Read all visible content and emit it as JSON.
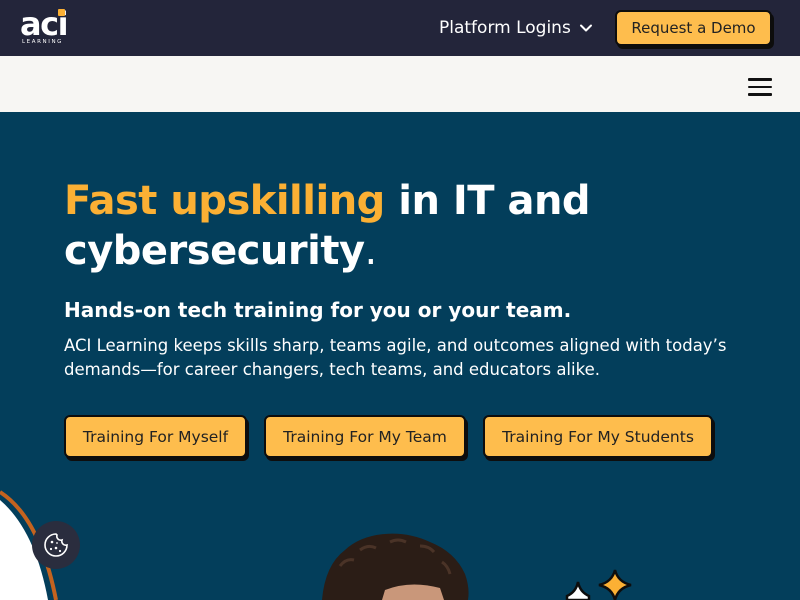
{
  "header": {
    "logo_text": "aci",
    "logo_subtext": "LEARNING",
    "platform_logins_label": "Platform Logins",
    "request_demo_label": "Request a Demo"
  },
  "hero": {
    "title_highlight": "Fast upskilling",
    "title_rest_1": " in IT and",
    "title_rest_2": "cybersecurity",
    "title_period": ".",
    "subtitle": "Hands-on tech training for you or your team.",
    "description": "ACI Learning keeps skills sharp, teams agile, and outcomes aligned with today’s demands—for career changers, tech teams, and educators alike.",
    "buttons": [
      {
        "label": "Training For Myself"
      },
      {
        "label": "Training For My Team"
      },
      {
        "label": "Training For My Students"
      }
    ]
  },
  "colors": {
    "hero_bg": "#033E5B",
    "top_bar": "#23253A",
    "accent": "#FBB034",
    "button": "#FEBD4D",
    "nav_bar": "#F7F6F3"
  },
  "icons": {
    "menu": "hamburger-menu-icon",
    "dropdown": "chevron-down-icon",
    "cookie": "cookie-icon",
    "sparkle": "sparkle-icon"
  }
}
